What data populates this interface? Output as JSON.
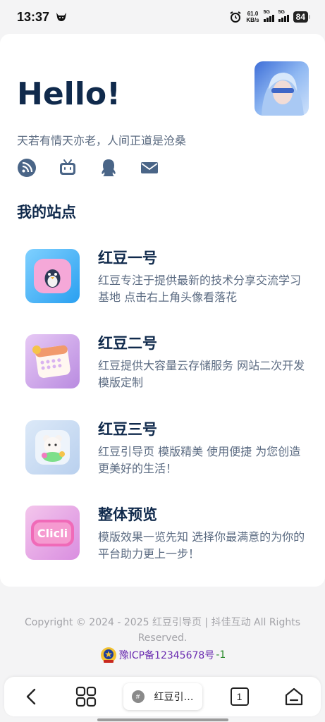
{
  "status": {
    "time": "13:37",
    "net_speed_value": "61.0",
    "net_speed_unit": "KB/s",
    "signal_1": "5G",
    "signal_2": "5G",
    "battery": "84"
  },
  "profile": {
    "greeting": "Hello!",
    "tagline": "天若有情天亦老，人间正道是沧桑",
    "avatar_icon": "avatar-illustration-blue-hair",
    "social_icons": [
      "rss-icon",
      "bilibili-icon",
      "qq-icon",
      "mail-icon"
    ]
  },
  "sites": {
    "title": "我的站点",
    "items": [
      {
        "title": "红豆一号",
        "desc": "红豆专注于提供最新的技术分享交流学习基地 点击右上角头像看落花",
        "icon": "penguin-fluffy-icon"
      },
      {
        "title": "红豆二号",
        "desc": "红豆提供大容量云存储服务 网站二次开发 模版定制",
        "icon": "calendar-3d-icon"
      },
      {
        "title": "红豆三号",
        "desc": "红豆引导页 模版精美 使用便捷 为您创造更美好的生活！",
        "icon": "bear-3d-icon"
      },
      {
        "title": "整体预览",
        "desc": "模版效果一览先知 选择你最满意的为你的平台助力更上一步！",
        "icon": "clicli-fluffy-icon"
      }
    ]
  },
  "footer": {
    "copyright": "Copyright © 2024 - 2025 红豆引导页 | 抖佳互动 All Rights Reserved.",
    "icp": "豫ICP备12345678号",
    "icp_suffix": "-1"
  },
  "nav": {
    "tab_title": "红豆引…",
    "tab_count": "1"
  },
  "colors": {
    "heading": "#102a4c",
    "body_text": "#5b6b82",
    "background": "#f4f4f5",
    "icp_link": "#6a2bb0"
  }
}
